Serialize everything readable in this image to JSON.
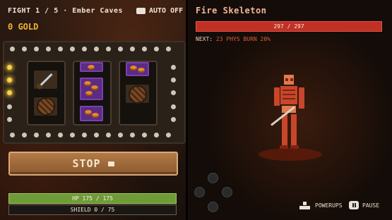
{
  "header": {
    "fight_label": "FIGHT 1 / 5 · Ember Caves",
    "gold_label": "0 GOLD",
    "auto_badge": "▭",
    "auto_label": "AUTO OFF"
  },
  "slot_machine": {
    "reels": [
      {
        "symbols": [
          "sword-icon",
          "shield-icon"
        ]
      },
      {
        "symbols": [
          "coin-icon",
          "coin-icon",
          "coin-icon"
        ]
      },
      {
        "symbols": [
          "coin-icon",
          "shield-icon"
        ]
      }
    ],
    "stop_button_label": "STOP"
  },
  "player": {
    "hp_label": "HP 175 / 175",
    "hp_fraction": 1.0,
    "shield_label": "SHIELD 0 / 75",
    "shield_fraction": 0.0
  },
  "enemy": {
    "name": "Fire Skeleton",
    "hp_label": "297 / 297",
    "hp_fraction": 1.0,
    "next_prefix": "NEXT:",
    "next_action": "23 PHYS",
    "next_effect": "BURN 20%"
  },
  "footer": {
    "powerups_label": "POWERUPS",
    "pause_label": "PAUSE"
  },
  "colors": {
    "gold": "#f0b22e",
    "hp_green": "#6f9a38",
    "enemy_red": "#c03025",
    "button_brown": "#a06a3a"
  }
}
